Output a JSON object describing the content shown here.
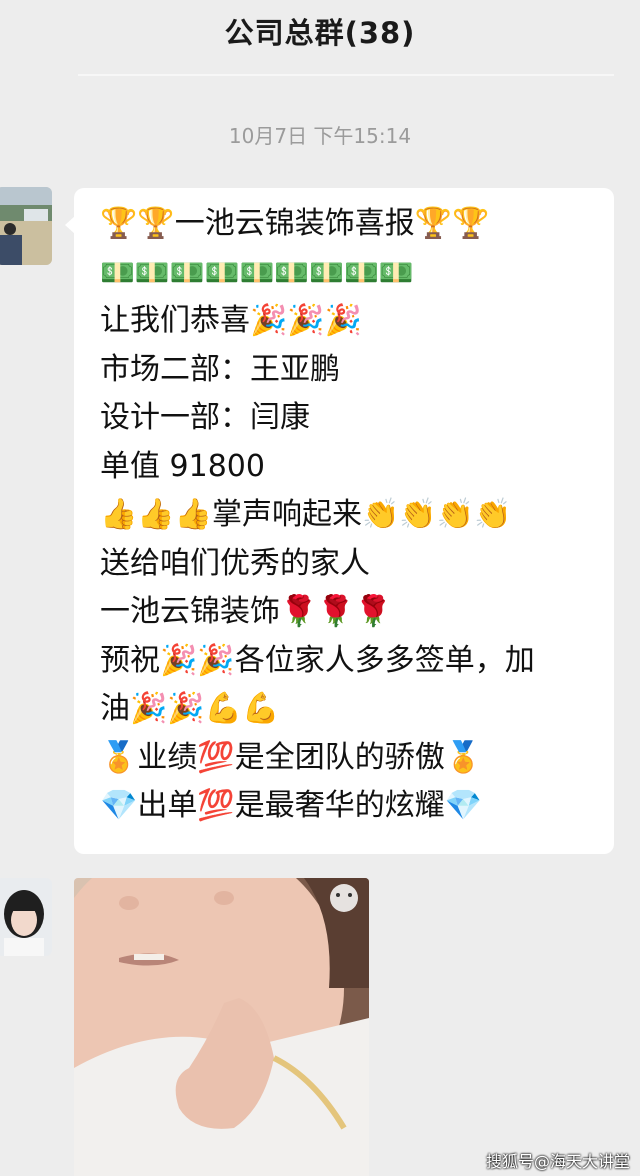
{
  "header": {
    "title": "公司总群(38)"
  },
  "timestamp": "10月7日 下午15:14",
  "message": {
    "lines": [
      "🏆🏆一池云锦装饰喜报🏆🏆",
      "💵💵💵💵💵💵💵💵💵",
      "让我们恭喜🎉🎉🎉",
      "市场二部：王亚鹏",
      "设计一部：闫康",
      "单值 91800",
      "👍👍👍掌声响起来👏👏👏👏",
      "送给咱们优秀的家人",
      "一池云锦装饰🌹🌹🌹",
      "预祝🎉🎉各位家人多多签单，加",
      "油🎉🎉💪💪",
      "🏅业绩💯是全团队的骄傲🏅",
      "💎出单💯是最奢华的炫耀💎"
    ]
  },
  "watermark": "搜狐号@海天大讲堂"
}
